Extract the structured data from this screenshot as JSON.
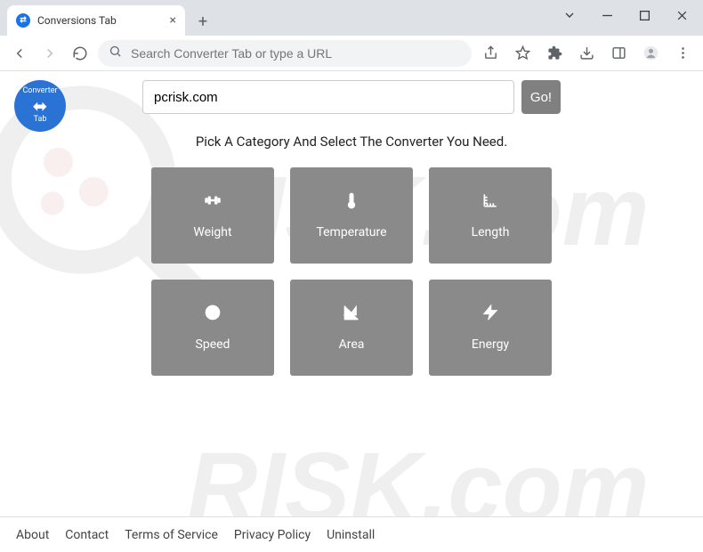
{
  "browser": {
    "tab_title": "Conversions Tab",
    "address_placeholder": "Search Converter Tab or type a URL"
  },
  "logo": {
    "line1": "Converter",
    "line2": "Tab"
  },
  "search": {
    "value": "pcrisk.com",
    "go_label": "Go!"
  },
  "subtitle": "Pick A Category And Select The Converter You Need.",
  "tiles": [
    {
      "label": "Weight",
      "icon": "weight-icon"
    },
    {
      "label": "Temperature",
      "icon": "thermometer-icon"
    },
    {
      "label": "Length",
      "icon": "ruler-icon"
    },
    {
      "label": "Speed",
      "icon": "speed-icon"
    },
    {
      "label": "Area",
      "icon": "area-icon"
    },
    {
      "label": "Energy",
      "icon": "energy-icon"
    }
  ],
  "footer": {
    "links": [
      "About",
      "Contact",
      "Terms of Service",
      "Privacy Policy",
      "Uninstall"
    ]
  }
}
